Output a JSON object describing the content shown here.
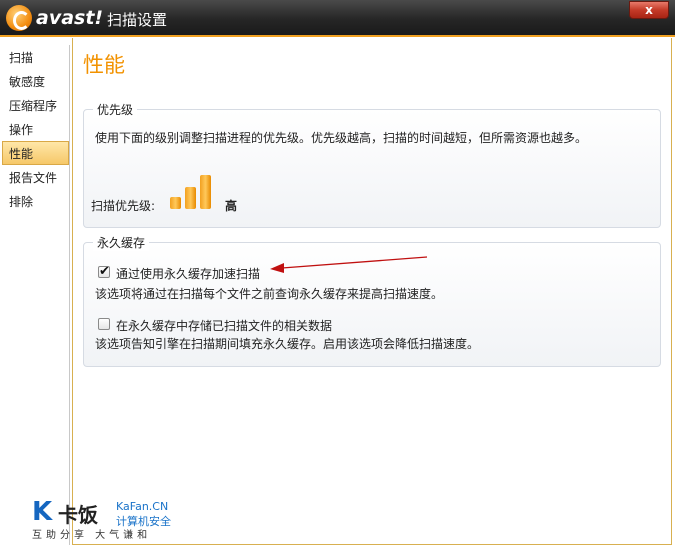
{
  "window": {
    "logo_text": "avast!",
    "title": "扫描设置",
    "close": "x"
  },
  "sidebar": {
    "items": [
      {
        "label": "扫描"
      },
      {
        "label": "敏感度"
      },
      {
        "label": "压缩程序"
      },
      {
        "label": "操作"
      },
      {
        "label": "性能",
        "active": true
      },
      {
        "label": "报告文件"
      },
      {
        "label": "排除"
      }
    ]
  },
  "main": {
    "title": "性能",
    "priority_group": {
      "label": "优先级",
      "description": "使用下面的级别调整扫描进程的优先级。优先级越高，扫描的时间越短，但所需资源也越多。",
      "setting_label": "扫描优先级:",
      "level_text": "高",
      "level_value": 3,
      "level_max": 3
    },
    "cache_group": {
      "label": "永久缓存",
      "option1": {
        "label": "通过使用永久缓存加速扫描",
        "checked": true,
        "description": "该选项将通过在扫描每个文件之前查询永久缓存来提高扫描速度。"
      },
      "option2": {
        "label": "在永久缓存中存储已扫描文件的相关数据",
        "checked": false,
        "description": "该选项告知引擎在扫描期间填充永久缓存。启用该选项会降低扫描速度。"
      }
    }
  },
  "watermark": {
    "mark": "K",
    "brand_cn": "卡饭",
    "brand_en": "KaFan.CN",
    "sub": "计算机安全",
    "slogan": "互助分享  大气谦和"
  },
  "colors": {
    "accent": "#f29200",
    "annotation_arrow": "#c01010"
  }
}
